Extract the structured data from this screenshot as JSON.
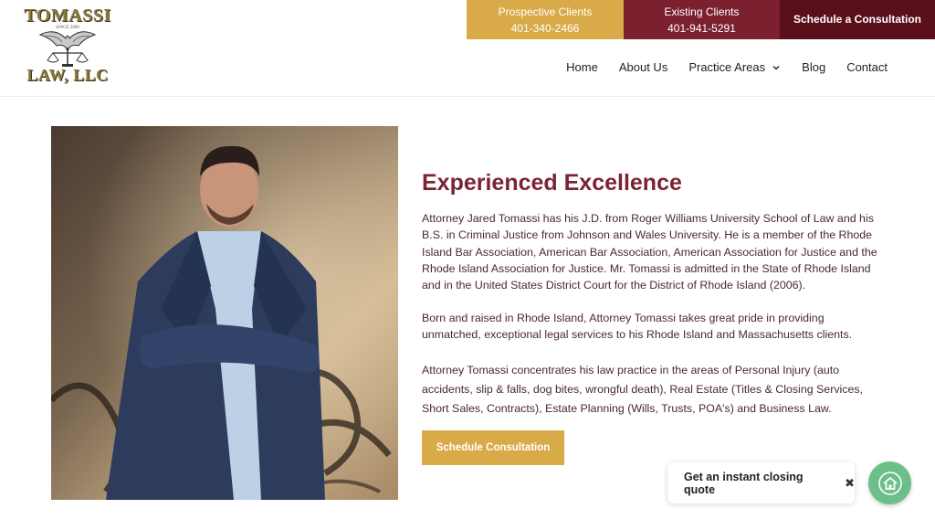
{
  "logo": {
    "top": "TOMASSI",
    "since": "SINCE 2006",
    "bottom": "LAW, LLC"
  },
  "topbar": {
    "prospective": {
      "label": "Prospective Clients",
      "phone": "401-340-2466",
      "color": "#d9aa48"
    },
    "existing": {
      "label": "Existing Clients",
      "phone": "401-941-5291",
      "color": "#7c2030"
    },
    "schedule": {
      "label": "Schedule a Consultation",
      "color": "#5a0e1a"
    }
  },
  "nav": {
    "home": "Home",
    "about": "About Us",
    "practice": "Practice Areas",
    "blog": "Blog",
    "contact": "Contact"
  },
  "main": {
    "heading": "Experienced Excellence",
    "paragraph1": "Attorney Jared Tomassi has his J.D. from Roger Williams University School of Law and his B.S. in Criminal Justice from Johnson and Wales University. He is a member of the Rhode Island Bar Association, American Bar Association, American Association for Justice and the Rhode Island Association for Justice. Mr. Tomassi is admitted in the State of Rhode Island and in the United States District Court for the District of Rhode Island (2006).",
    "paragraph2": "Born and raised in Rhode Island, Attorney Tomassi takes great pride in providing unmatched, exceptional legal services to his Rhode Island and Massachusetts clients.",
    "paragraph3": "Attorney Tomassi concentrates his law practice in the areas of Personal Injury (auto accidents, slip & falls, dog bites, wrongful death), Real Estate (Titles & Closing Services, Short Sales, Contracts), Estate Planning (Wills, Trusts, POA's) and Business Law.",
    "cta": "Schedule Consultation"
  },
  "widget": {
    "quote_label": "Get an instant closing quote",
    "close_glyph": "✖",
    "icon": "home-icon",
    "color": "#6cbf8a"
  },
  "colors": {
    "accent": "#7a2431",
    "gold": "#d9aa48"
  }
}
